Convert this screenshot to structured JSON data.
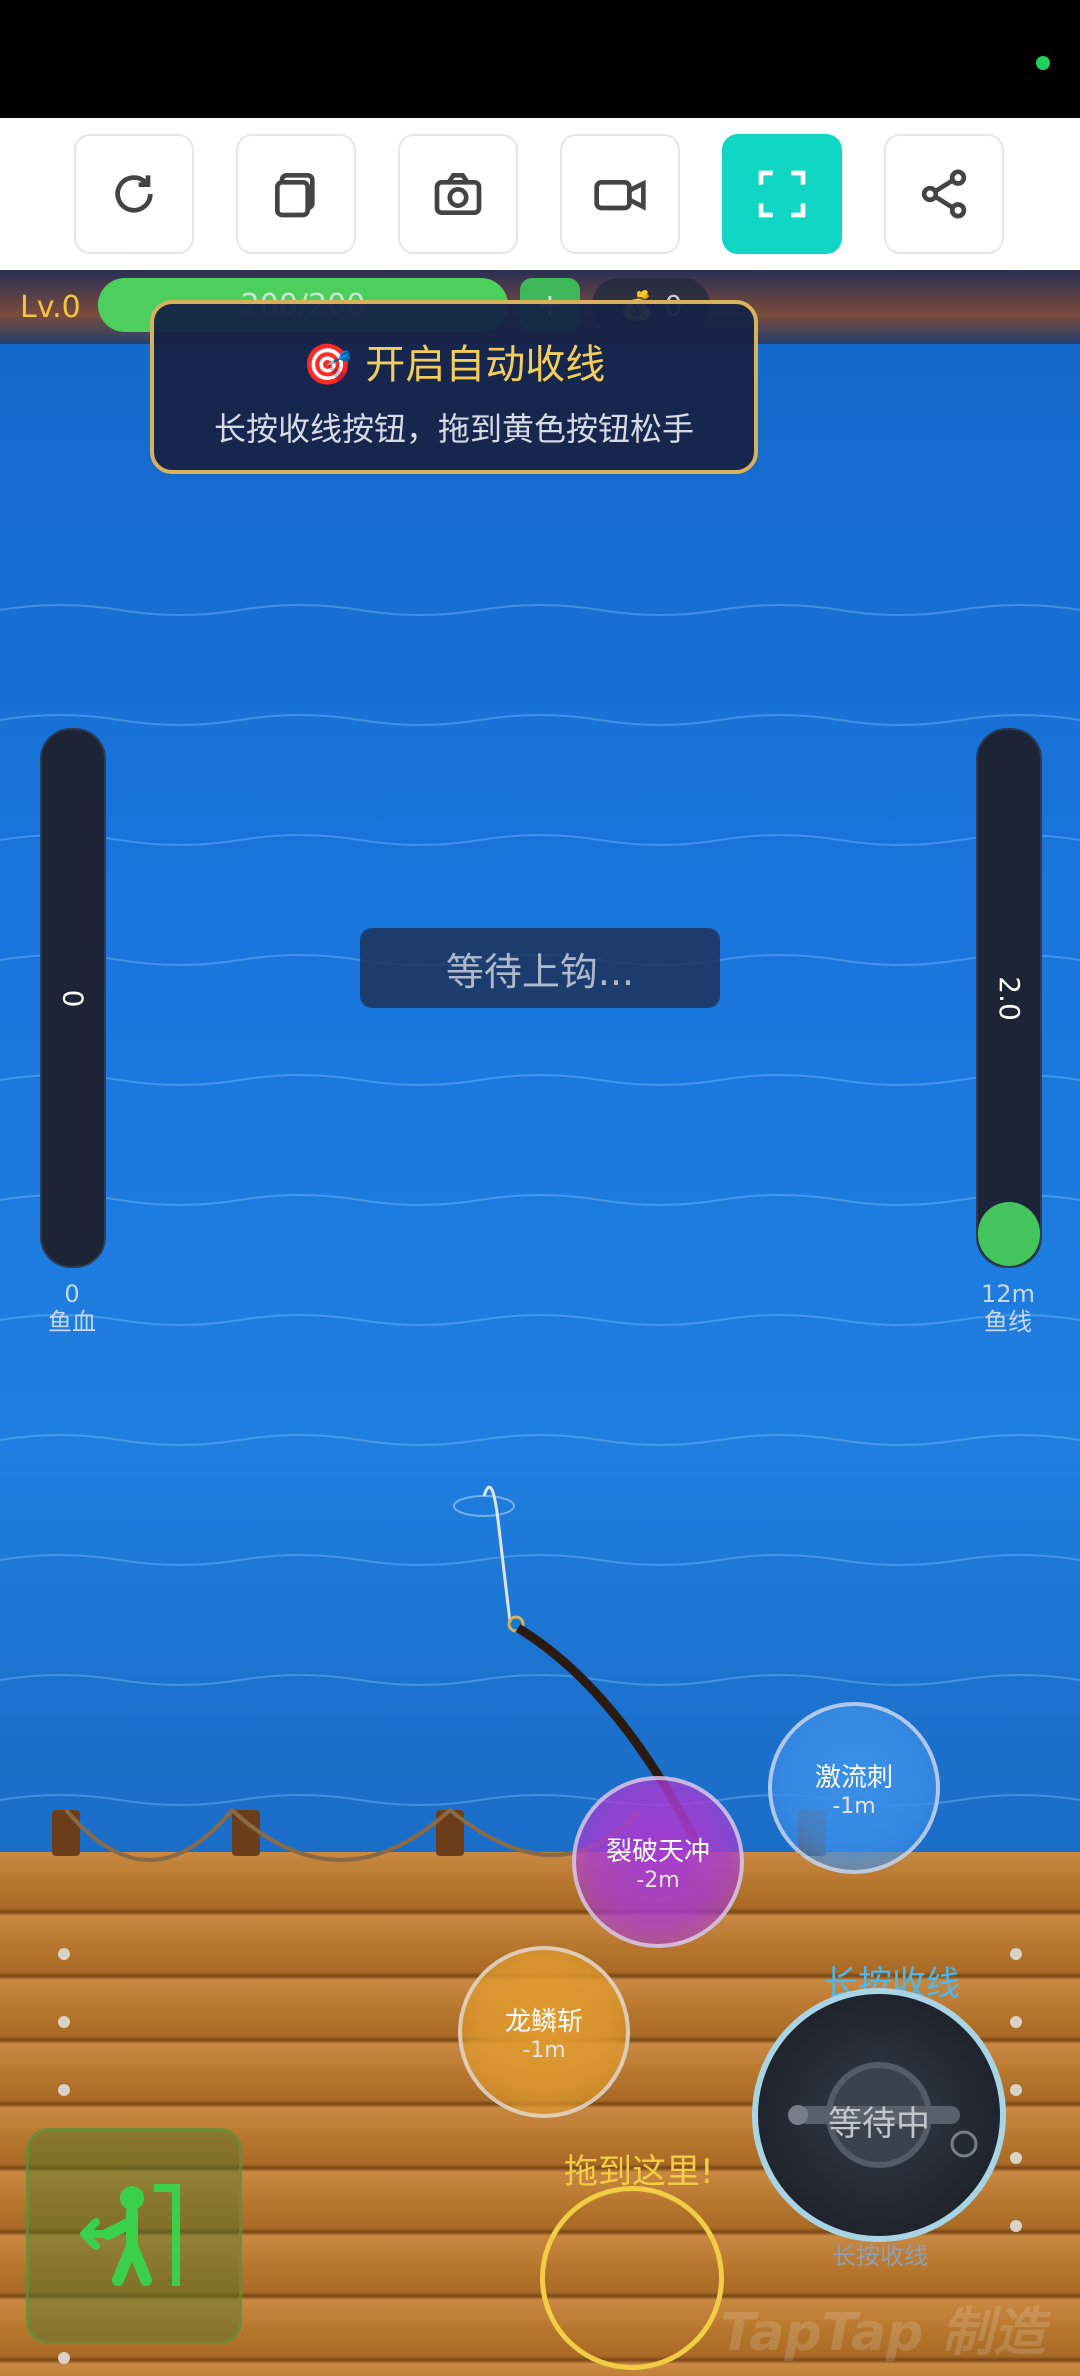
{
  "toolbar": {
    "buttons": [
      {
        "icon": "refresh-icon"
      },
      {
        "icon": "copy-icon"
      },
      {
        "icon": "camera-icon"
      },
      {
        "icon": "video-icon"
      },
      {
        "icon": "fullscreen-icon",
        "active": true
      },
      {
        "icon": "share-icon"
      }
    ],
    "accent_color": "#10d6c4"
  },
  "hud": {
    "level": "Lv.0",
    "hp_text": "200/200",
    "plus_label": "+",
    "coins": "0"
  },
  "tip": {
    "title": "开启自动收线",
    "text": "长按收线按钮，拖到黄色按钮松手"
  },
  "meters": {
    "fish_hp": {
      "value": "0",
      "bottom_value": "0",
      "label": "鱼血",
      "fill": 0
    },
    "line": {
      "value": "2.0",
      "bottom_value": "12m",
      "label": "鱼线",
      "fill": 0.12
    }
  },
  "status": "等待上钩...",
  "skills": [
    {
      "name": "激流刺",
      "cost": "-1m",
      "color": "#3b8fe8"
    },
    {
      "name": "裂破天冲",
      "cost": "-2m",
      "color": "#a63bd0"
    },
    {
      "name": "龙鳞斩",
      "cost": "-1m",
      "color": "#e09a2f"
    }
  ],
  "reel": {
    "label": "长按收线",
    "state": "等待中",
    "caption": "长按收线"
  },
  "drag_target": "拖到这里!",
  "watermark": "TapTap 制造"
}
